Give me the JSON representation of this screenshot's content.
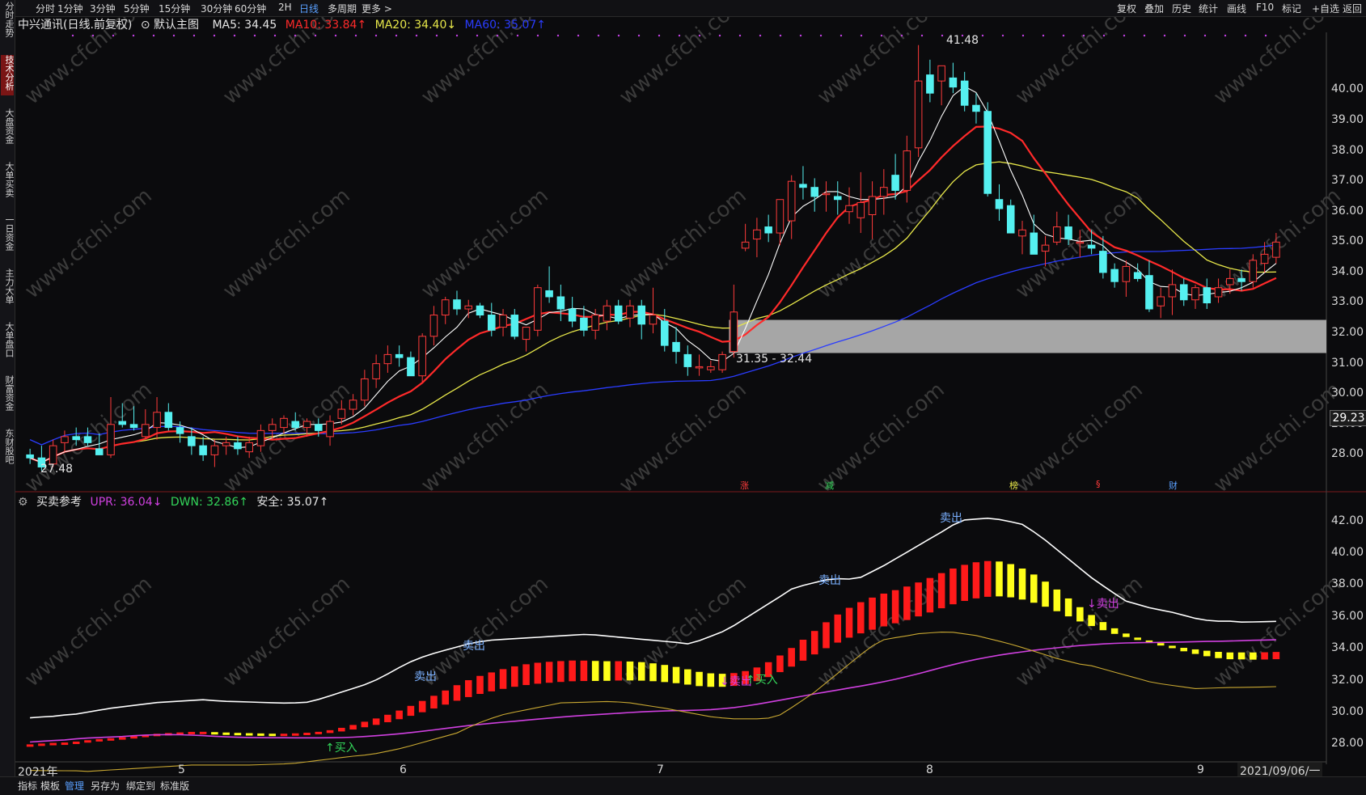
{
  "toolbar": {
    "periods": [
      "分时",
      "1分钟",
      "3分钟",
      "5分钟",
      "15分钟",
      "30分钟",
      "60分钟",
      "2H",
      "日线",
      "多周期",
      "更多 >"
    ],
    "active_period": "日线",
    "right_items": [
      "复权",
      "叠加",
      "历史",
      "统计",
      "画线",
      "F10",
      "标记",
      "+自选",
      "返回"
    ]
  },
  "sidebar": {
    "tabs": [
      "分时走势",
      "技术分析",
      "大盘资金",
      "大单买卖",
      "一日资金",
      "主力大单",
      "大单盘口",
      "财富资金",
      "东财股吧"
    ],
    "active": "技术分析"
  },
  "main_legend": {
    "name": "中兴通讯(日线.前复权)",
    "template": "默认主图",
    "ma5": "MA5: 34.45",
    "ma10": "MA10: 33.84↑",
    "ma20": "MA20: 34.40↓",
    "ma60": "MA60: 35.07↑",
    "colors": {
      "ma5": "#ffffff",
      "ma10": "#ff2a2a",
      "ma20": "#e8e84a",
      "ma60": "#2a3cff"
    }
  },
  "sub_legend": {
    "name": "买卖参考",
    "upr": "UPR: 36.04↓",
    "dwn": "DWN: 32.86↑",
    "safe": "安全: 35.07↑"
  },
  "price_axis": {
    "labels": [
      "40.00",
      "39.00",
      "38.00",
      "37.00",
      "36.00",
      "35.00",
      "34.00",
      "33.00",
      "32.00",
      "31.00",
      "30.00",
      "29.00",
      "28.00"
    ],
    "current": "29.23"
  },
  "sub_axis": {
    "labels": [
      "42.00",
      "40.00",
      "38.00",
      "36.00",
      "34.00",
      "32.00",
      "30.00",
      "28.00"
    ]
  },
  "x_axis": {
    "labels": [
      "2021年",
      "5",
      "6",
      "7",
      "8",
      "9"
    ],
    "cursor_date": "2021/09/06/一"
  },
  "annotations": {
    "high": "41.48",
    "low": "27.48",
    "gap_range": "31.35 - 32.44",
    "events": [
      "涨",
      "减",
      "榜",
      "§",
      "财"
    ],
    "sub_signals": {
      "sell": "卖出",
      "sell_arrow": "↓卖出",
      "buy": "↑买入"
    }
  },
  "bottom_tabs": [
    "指标",
    "模板",
    "管理",
    "另存为",
    "绑定到",
    "标准版"
  ],
  "bottom_active": "管理",
  "watermark": "www.cfchi.com",
  "chart_data": {
    "type": "candlestick",
    "ohlc": [
      [
        28.0,
        28.2,
        27.7,
        27.9
      ],
      [
        27.9,
        28.3,
        27.48,
        27.6
      ],
      [
        27.7,
        28.5,
        27.6,
        28.3
      ],
      [
        28.4,
        28.8,
        28.1,
        28.6
      ],
      [
        28.6,
        28.9,
        28.3,
        28.5
      ],
      [
        28.6,
        28.9,
        28.3,
        28.4
      ],
      [
        28.2,
        28.7,
        28.0,
        28.0
      ],
      [
        28.0,
        29.9,
        27.9,
        29.0
      ],
      [
        29.1,
        29.7,
        28.9,
        29.0
      ],
      [
        29.0,
        29.6,
        28.8,
        28.9
      ],
      [
        28.6,
        29.5,
        28.5,
        29.0
      ],
      [
        28.9,
        29.9,
        28.5,
        29.4
      ],
      [
        29.4,
        29.7,
        28.8,
        28.9
      ],
      [
        28.9,
        29.1,
        28.4,
        28.7
      ],
      [
        28.6,
        28.9,
        28.0,
        28.3
      ],
      [
        28.3,
        28.6,
        27.8,
        28.0
      ],
      [
        28.0,
        28.5,
        27.6,
        28.3
      ],
      [
        28.3,
        28.6,
        28.0,
        28.4
      ],
      [
        28.4,
        28.6,
        28.0,
        28.2
      ],
      [
        28.1,
        28.6,
        27.9,
        28.4
      ],
      [
        28.3,
        29.0,
        28.1,
        28.8
      ],
      [
        28.8,
        29.2,
        28.5,
        29.0
      ],
      [
        28.9,
        29.3,
        28.7,
        29.2
      ],
      [
        29.1,
        29.4,
        28.8,
        28.9
      ],
      [
        28.9,
        29.2,
        28.6,
        29.1
      ],
      [
        29.0,
        29.2,
        28.6,
        28.8
      ],
      [
        28.6,
        29.3,
        28.3,
        29.1
      ],
      [
        29.2,
        29.8,
        29.0,
        29.5
      ],
      [
        29.5,
        30.0,
        29.3,
        29.8
      ],
      [
        29.8,
        30.8,
        29.6,
        30.5
      ],
      [
        30.5,
        31.3,
        30.2,
        31.0
      ],
      [
        31.0,
        31.6,
        30.7,
        31.3
      ],
      [
        31.3,
        31.6,
        30.9,
        31.2
      ],
      [
        31.2,
        31.4,
        30.6,
        30.6
      ],
      [
        30.6,
        32.0,
        30.4,
        31.9
      ],
      [
        31.9,
        32.9,
        31.6,
        32.6
      ],
      [
        32.6,
        33.2,
        32.3,
        33.1
      ],
      [
        33.1,
        33.4,
        32.6,
        32.8
      ],
      [
        32.8,
        33.1,
        32.5,
        32.9
      ],
      [
        32.9,
        33.0,
        32.5,
        32.6
      ],
      [
        32.6,
        33.0,
        31.9,
        32.1
      ],
      [
        32.2,
        32.8,
        31.9,
        32.6
      ],
      [
        32.6,
        32.8,
        31.8,
        31.9
      ],
      [
        31.8,
        32.2,
        31.4,
        32.2
      ],
      [
        32.1,
        33.6,
        31.9,
        33.5
      ],
      [
        33.4,
        34.2,
        33.0,
        33.2
      ],
      [
        33.2,
        33.6,
        32.4,
        32.8
      ],
      [
        32.8,
        33.2,
        32.2,
        32.4
      ],
      [
        32.5,
        32.9,
        31.9,
        32.1
      ],
      [
        32.1,
        32.8,
        31.8,
        32.6
      ],
      [
        32.4,
        33.1,
        32.1,
        32.9
      ],
      [
        32.9,
        33.1,
        32.3,
        32.4
      ],
      [
        32.5,
        33.1,
        32.2,
        32.9
      ],
      [
        32.9,
        33.1,
        31.8,
        32.3
      ],
      [
        32.3,
        33.5,
        32.0,
        32.6
      ],
      [
        32.4,
        32.8,
        31.4,
        31.6
      ],
      [
        31.7,
        32.2,
        31.0,
        31.4
      ],
      [
        31.3,
        31.6,
        30.6,
        30.9
      ],
      [
        30.9,
        31.3,
        30.6,
        30.9
      ],
      [
        30.8,
        31.1,
        30.7,
        30.9
      ],
      [
        30.8,
        31.4,
        30.7,
        31.3
      ],
      [
        31.4,
        33.6,
        31.2,
        32.7
      ],
      [
        34.8,
        35.6,
        34.7,
        35.0
      ],
      [
        35.1,
        35.8,
        34.5,
        35.4
      ],
      [
        35.5,
        35.9,
        35.0,
        35.3
      ],
      [
        35.3,
        36.2,
        34.9,
        36.4
      ],
      [
        35.7,
        37.2,
        35.1,
        37.0
      ],
      [
        36.9,
        37.5,
        36.4,
        36.8
      ],
      [
        36.8,
        37.1,
        36.0,
        36.5
      ],
      [
        36.6,
        37.0,
        36.0,
        36.6
      ],
      [
        36.5,
        37.0,
        35.9,
        36.4
      ],
      [
        36.0,
        36.8,
        35.6,
        36.2
      ],
      [
        35.8,
        37.3,
        35.3,
        36.3
      ],
      [
        35.9,
        37.0,
        35.1,
        36.5
      ],
      [
        36.5,
        37.4,
        35.9,
        36.8
      ],
      [
        37.2,
        37.9,
        36.4,
        36.7
      ],
      [
        36.7,
        38.5,
        36.3,
        38.0
      ],
      [
        38.1,
        41.48,
        37.8,
        40.3
      ],
      [
        40.5,
        41.0,
        39.6,
        39.9
      ],
      [
        40.3,
        40.8,
        39.5,
        40.8
      ],
      [
        40.4,
        40.9,
        39.9,
        40.1
      ],
      [
        40.3,
        40.6,
        39.3,
        39.5
      ],
      [
        39.5,
        39.9,
        38.9,
        39.3
      ],
      [
        39.3,
        39.6,
        36.5,
        36.6
      ],
      [
        36.4,
        36.9,
        35.7,
        36.1
      ],
      [
        36.2,
        36.4,
        35.3,
        35.3
      ],
      [
        35.2,
        35.7,
        34.6,
        35.4
      ],
      [
        35.3,
        35.9,
        34.8,
        34.6
      ],
      [
        34.7,
        35.2,
        34.2,
        34.9
      ],
      [
        35.0,
        36.0,
        34.9,
        35.5
      ],
      [
        35.5,
        35.9,
        34.9,
        35.1
      ],
      [
        35.0,
        35.4,
        34.5,
        35.0
      ],
      [
        34.9,
        35.4,
        34.6,
        34.8
      ],
      [
        34.7,
        35.2,
        33.8,
        34.0
      ],
      [
        34.1,
        34.3,
        33.5,
        33.7
      ],
      [
        33.7,
        34.4,
        33.2,
        34.2
      ],
      [
        34.0,
        34.3,
        33.7,
        33.8
      ],
      [
        33.9,
        34.4,
        32.7,
        32.8
      ],
      [
        32.9,
        33.5,
        32.5,
        33.2
      ],
      [
        33.2,
        34.1,
        32.6,
        33.6
      ],
      [
        33.6,
        33.8,
        32.9,
        33.1
      ],
      [
        33.1,
        33.6,
        32.8,
        33.5
      ],
      [
        33.5,
        33.8,
        32.8,
        33.0
      ],
      [
        33.2,
        33.8,
        33.0,
        33.5
      ],
      [
        33.6,
        34.1,
        33.3,
        33.8
      ],
      [
        33.8,
        34.1,
        33.4,
        33.7
      ],
      [
        33.7,
        34.6,
        33.5,
        34.4
      ],
      [
        34.3,
        35.0,
        34.0,
        34.6
      ],
      [
        34.5,
        35.3,
        34.3,
        35.0
      ]
    ],
    "series": [
      {
        "name": "MA5"
      },
      {
        "name": "MA10"
      },
      {
        "name": "MA20"
      },
      {
        "name": "MA60"
      },
      {
        "name": "UPR"
      },
      {
        "name": "DWN"
      },
      {
        "name": "安全"
      }
    ],
    "ylim": [
      27.0,
      41.9
    ],
    "sub_ylim": [
      27.0,
      43.0
    ]
  }
}
